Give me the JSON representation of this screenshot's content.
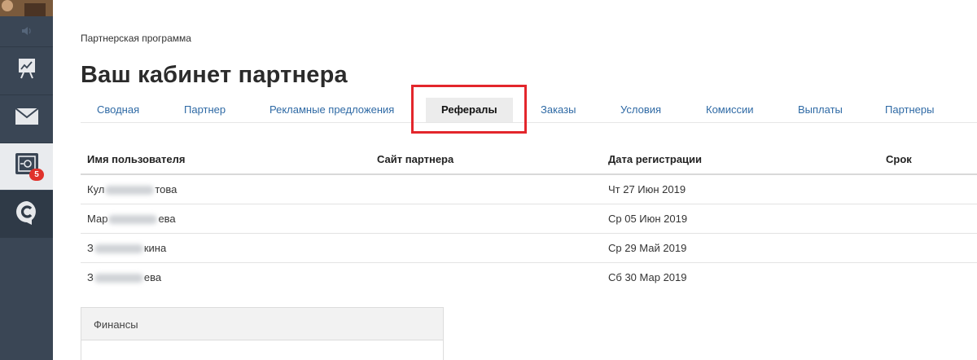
{
  "sidebar": {
    "badge_count": "5",
    "items": [
      {
        "icon": "chart-board-icon"
      },
      {
        "icon": "mail-icon"
      },
      {
        "icon": "partner-safe-icon",
        "active": true
      },
      {
        "icon": "c-logo-icon"
      }
    ]
  },
  "breadcrumb": "Партнерская программа",
  "page_title": "Ваш кабинет партнера",
  "tabs": [
    {
      "label": "Сводная"
    },
    {
      "label": "Партнер"
    },
    {
      "label": "Рекламные предложения"
    },
    {
      "label": "Рефералы",
      "active": true
    },
    {
      "label": "Заказы"
    },
    {
      "label": "Условия"
    },
    {
      "label": "Комиссии"
    },
    {
      "label": "Выплаты"
    },
    {
      "label": "Партнеры"
    }
  ],
  "table": {
    "headers": [
      "Имя пользователя",
      "Сайт партнера",
      "Дата регистрации",
      "Срок"
    ],
    "rows": [
      {
        "name_start": "Кул",
        "name_end": "това",
        "site": "",
        "date": "Чт 27 Июн 2019",
        "term": ""
      },
      {
        "name_start": "Мар",
        "name_end": "ева",
        "site": "",
        "date": "Ср 05 Июн 2019",
        "term": ""
      },
      {
        "name_start": "З",
        "name_end": "кина",
        "site": "",
        "date": "Ср 29 Май 2019",
        "term": ""
      },
      {
        "name_start": "З",
        "name_end": "ева",
        "site": "",
        "date": "Сб 30 Мар 2019",
        "term": ""
      }
    ]
  },
  "finance": {
    "title": "Финансы"
  },
  "colors": {
    "sidebar_bg": "#3a4655",
    "link": "#2f6aa5",
    "highlight": "#e3262c",
    "badge": "#e0322c"
  }
}
